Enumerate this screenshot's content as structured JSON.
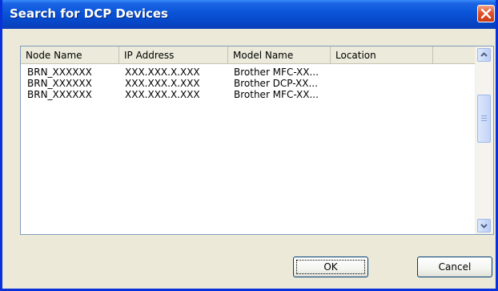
{
  "window": {
    "title": "Search for DCP Devices",
    "close_icon": "close-icon"
  },
  "list": {
    "columns": [
      "Node Name",
      "IP Address",
      "Model Name",
      "Location"
    ],
    "rows": [
      {
        "node": "BRN_XXXXXX",
        "ip": "XXX.XXX.X.XXX",
        "model": "Brother MFC-XX...",
        "location": ""
      },
      {
        "node": "BRN_XXXXXX",
        "ip": "XXX.XXX.X.XXX",
        "model": "Brother DCP-XX...",
        "location": ""
      },
      {
        "node": "BRN_XXXXXX",
        "ip": "XXX.XXX.X.XXX",
        "model": "Brother MFC-XX...",
        "location": ""
      }
    ]
  },
  "buttons": {
    "ok": "OK",
    "cancel": "Cancel"
  },
  "colors": {
    "titlebar": "#0a54d8",
    "close": "#e0522c",
    "dialog_bg": "#ece9d8"
  }
}
